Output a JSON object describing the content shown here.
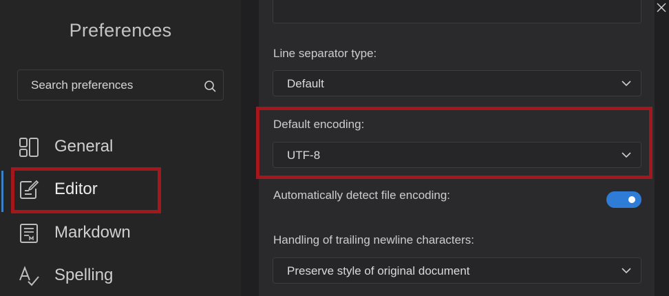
{
  "sidebar": {
    "title": "Preferences",
    "search": {
      "placeholder": "Search preferences",
      "icon": "search-icon"
    },
    "items": [
      {
        "label": "General",
        "icon": "layout-icon"
      },
      {
        "label": "Editor",
        "icon": "edit-icon",
        "active": true
      },
      {
        "label": "Markdown",
        "icon": "markdown-icon"
      },
      {
        "label": "Spelling",
        "icon": "spellcheck-icon"
      }
    ]
  },
  "main": {
    "line_separator": {
      "label": "Line separator type:",
      "value": "Default"
    },
    "default_encoding": {
      "label": "Default encoding:",
      "value": "UTF-8"
    },
    "auto_detect": {
      "label": "Automatically detect file encoding:",
      "enabled": true
    },
    "trailing_newline": {
      "label": "Handling of trailing newline characters:",
      "value": "Preserve style of original document"
    }
  },
  "colors": {
    "accent": "#2f7cd6",
    "highlight": "#a3171d",
    "active_bar": "#3b82c4"
  }
}
